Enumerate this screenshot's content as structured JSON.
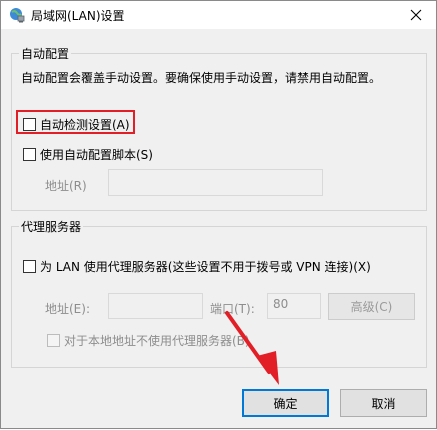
{
  "window": {
    "title": "局域网(LAN)设置"
  },
  "auto_config": {
    "group_label": "自动配置",
    "description": "自动配置会覆盖手动设置。要确保使用手动设置，请禁用自动配置。",
    "auto_detect_label": "自动检测设置(A)",
    "auto_detect_checked": false,
    "script_label": "使用自动配置脚本(S)",
    "script_checked": false,
    "address_label": "地址(R)",
    "address_value": ""
  },
  "proxy": {
    "group_label": "代理服务器",
    "use_proxy_label": "为 LAN 使用代理服务器(这些设置不用于拨号或 VPN 连接)(X)",
    "use_proxy_checked": false,
    "address_label": "地址(E):",
    "address_value": "",
    "port_label": "端口(T):",
    "port_value": "80",
    "advanced_label": "高级(C)",
    "bypass_label": "对于本地地址不使用代理服务器(B)",
    "bypass_checked": false
  },
  "buttons": {
    "ok": "确定",
    "cancel": "取消"
  },
  "colors": {
    "highlight": "#e21f26",
    "arrow": "#e21f26",
    "accent": "#0078d7"
  }
}
